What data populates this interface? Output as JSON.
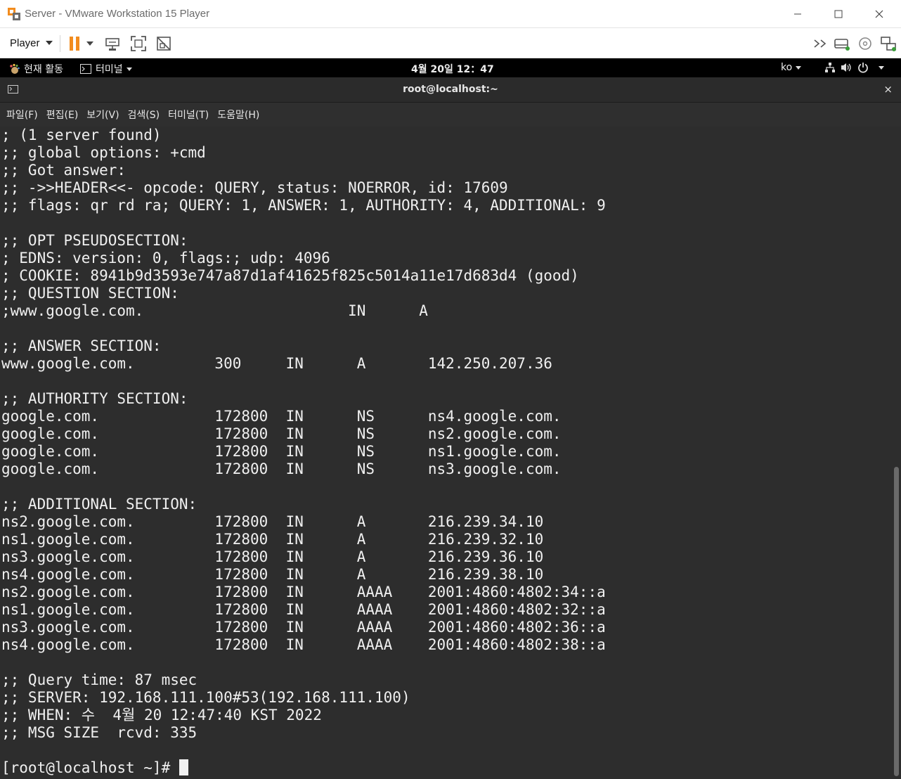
{
  "window": {
    "title": "Server - VMware Workstation 15 Player"
  },
  "toolbar": {
    "player_label": "Player",
    "icons": [
      "pause-icon",
      "send-ctrl-alt-del-icon",
      "fullscreen-icon",
      "unity-icon",
      "more-icon",
      "removable-devices-icon",
      "cd-icon",
      "network-icon"
    ]
  },
  "gnome_bar": {
    "activities": "현재 활동",
    "app_menu": "터미널",
    "clock": "4월 20일  12：47",
    "input_method": "ko"
  },
  "terminal": {
    "title": "root@localhost:~",
    "close_glyph": "×",
    "menu": [
      "파일(F)",
      "편집(E)",
      "보기(V)",
      "검색(S)",
      "터미널(T)",
      "도움말(H)"
    ],
    "lines": [
      "; (1 server found)",
      ";; global options: +cmd",
      ";; Got answer:",
      ";; ->>HEADER<<- opcode: QUERY, status: NOERROR, id: 17609",
      ";; flags: qr rd ra; QUERY: 1, ANSWER: 1, AUTHORITY: 4, ADDITIONAL: 9",
      "",
      ";; OPT PSEUDOSECTION:",
      "; EDNS: version: 0, flags:; udp: 4096",
      "; COOKIE: 8941b9d3593e747a87d1af41625f825c5014a11e17d683d4 (good)",
      ";; QUESTION SECTION:",
      ";www.google.com.                       IN      A",
      "",
      ";; ANSWER SECTION:",
      "www.google.com.         300     IN      A       142.250.207.36",
      "",
      ";; AUTHORITY SECTION:",
      "google.com.             172800  IN      NS      ns4.google.com.",
      "google.com.             172800  IN      NS      ns2.google.com.",
      "google.com.             172800  IN      NS      ns1.google.com.",
      "google.com.             172800  IN      NS      ns3.google.com.",
      "",
      ";; ADDITIONAL SECTION:",
      "ns2.google.com.         172800  IN      A       216.239.34.10",
      "ns1.google.com.         172800  IN      A       216.239.32.10",
      "ns3.google.com.         172800  IN      A       216.239.36.10",
      "ns4.google.com.         172800  IN      A       216.239.38.10",
      "ns2.google.com.         172800  IN      AAAA    2001:4860:4802:34::a",
      "ns1.google.com.         172800  IN      AAAA    2001:4860:4802:32::a",
      "ns3.google.com.         172800  IN      AAAA    2001:4860:4802:36::a",
      "ns4.google.com.         172800  IN      AAAA    2001:4860:4802:38::a",
      "",
      ";; Query time: 87 msec",
      ";; SERVER: 192.168.111.100#53(192.168.111.100)",
      ";; WHEN: 수  4월 20 12:47:40 KST 2022",
      ";; MSG SIZE  rcvd: 335",
      ""
    ],
    "prompt": "[root@localhost ~]# "
  },
  "colors": {
    "terminal_bg": "#2d2d2d",
    "terminal_fg": "#f0f0f0",
    "pause_accent": "#f28c1e",
    "gnome_bar_bg": "#000000"
  }
}
